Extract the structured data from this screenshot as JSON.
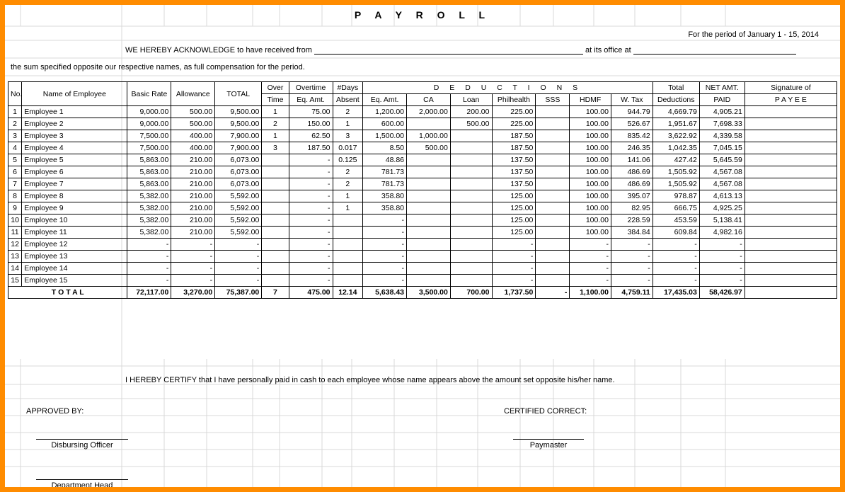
{
  "title": "P A Y R O L L",
  "period_prefix": "For the period of",
  "period_value": "January 1 - 15,  2014",
  "ack_line_1a": "WE HEREBY ACKNOWLEDGE to have received from",
  "ack_line_1b": "at its office at",
  "ack_line_2": "the sum specified opposite our respective names, as full compensation for the period.",
  "headers": {
    "no": "No.",
    "name": "Name of Employee",
    "basic": "Basic Rate",
    "allow": "Allowance",
    "total": "TOTAL",
    "over": "Over",
    "overtime": "Overtime",
    "days": "#Days",
    "deductions": "D  E  D  U  C  T  I  O  N  S",
    "time": "Time",
    "eqamt": "Eq. Amt.",
    "absent": "Absent",
    "eqamt2": "Eq. Amt.",
    "ca": "CA",
    "loan": "Loan",
    "philhealth": "Philhealth",
    "sss": "SSS",
    "hdmf": "HDMF",
    "wtax": "W. Tax",
    "tdeduct": "Total",
    "deductions2": "Deductions",
    "netamt": "NET AMT.",
    "paid": "PAID",
    "sig": "Signature of",
    "payee": "P A Y E E"
  },
  "rows": [
    {
      "no": "1",
      "name": "Employee 1",
      "basic": "9,000.00",
      "allow": "500.00",
      "total": "9,500.00",
      "ot": "1",
      "oeq": "75.00",
      "da": "2",
      "eq": "1,200.00",
      "ca": "2,000.00",
      "loan": "200.00",
      "ph": "225.00",
      "sss": "",
      "hd": "100.00",
      "wt": "944.79",
      "td": "4,669.79",
      "np": "4,905.21"
    },
    {
      "no": "2",
      "name": "Employee 2",
      "basic": "9,000.00",
      "allow": "500.00",
      "total": "9,500.00",
      "ot": "2",
      "oeq": "150.00",
      "da": "1",
      "eq": "600.00",
      "ca": "",
      "loan": "500.00",
      "ph": "225.00",
      "sss": "",
      "hd": "100.00",
      "wt": "526.67",
      "td": "1,951.67",
      "np": "7,698.33"
    },
    {
      "no": "3",
      "name": "Employee 3",
      "basic": "7,500.00",
      "allow": "400.00",
      "total": "7,900.00",
      "ot": "1",
      "oeq": "62.50",
      "da": "3",
      "eq": "1,500.00",
      "ca": "1,000.00",
      "loan": "",
      "ph": "187.50",
      "sss": "",
      "hd": "100.00",
      "wt": "835.42",
      "td": "3,622.92",
      "np": "4,339.58"
    },
    {
      "no": "4",
      "name": "Employee 4",
      "basic": "7,500.00",
      "allow": "400.00",
      "total": "7,900.00",
      "ot": "3",
      "oeq": "187.50",
      "da": "0.017",
      "eq": "8.50",
      "ca": "500.00",
      "loan": "",
      "ph": "187.50",
      "sss": "",
      "hd": "100.00",
      "wt": "246.35",
      "td": "1,042.35",
      "np": "7,045.15"
    },
    {
      "no": "5",
      "name": "Employee 5",
      "basic": "5,863.00",
      "allow": "210.00",
      "total": "6,073.00",
      "ot": "",
      "oeq": "-",
      "da": "0.125",
      "eq": "48.86",
      "ca": "",
      "loan": "",
      "ph": "137.50",
      "sss": "",
      "hd": "100.00",
      "wt": "141.06",
      "td": "427.42",
      "np": "5,645.59"
    },
    {
      "no": "6",
      "name": "Employee 6",
      "basic": "5,863.00",
      "allow": "210.00",
      "total": "6,073.00",
      "ot": "",
      "oeq": "-",
      "da": "2",
      "eq": "781.73",
      "ca": "",
      "loan": "",
      "ph": "137.50",
      "sss": "",
      "hd": "100.00",
      "wt": "486.69",
      "td": "1,505.92",
      "np": "4,567.08"
    },
    {
      "no": "7",
      "name": "Employee 7",
      "basic": "5,863.00",
      "allow": "210.00",
      "total": "6,073.00",
      "ot": "",
      "oeq": "-",
      "da": "2",
      "eq": "781.73",
      "ca": "",
      "loan": "",
      "ph": "137.50",
      "sss": "",
      "hd": "100.00",
      "wt": "486.69",
      "td": "1,505.92",
      "np": "4,567.08"
    },
    {
      "no": "8",
      "name": "Employee 8",
      "basic": "5,382.00",
      "allow": "210.00",
      "total": "5,592.00",
      "ot": "",
      "oeq": "-",
      "da": "1",
      "eq": "358.80",
      "ca": "",
      "loan": "",
      "ph": "125.00",
      "sss": "",
      "hd": "100.00",
      "wt": "395.07",
      "td": "978.87",
      "np": "4,613.13"
    },
    {
      "no": "9",
      "name": "Employee 9",
      "basic": "5,382.00",
      "allow": "210.00",
      "total": "5,592.00",
      "ot": "",
      "oeq": "-",
      "da": "1",
      "eq": "358.80",
      "ca": "",
      "loan": "",
      "ph": "125.00",
      "sss": "",
      "hd": "100.00",
      "wt": "82.95",
      "td": "666.75",
      "np": "4,925.25"
    },
    {
      "no": "10",
      "name": "Employee 10",
      "basic": "5,382.00",
      "allow": "210.00",
      "total": "5,592.00",
      "ot": "",
      "oeq": "-",
      "da": "",
      "eq": "-",
      "ca": "",
      "loan": "",
      "ph": "125.00",
      "sss": "",
      "hd": "100.00",
      "wt": "228.59",
      "td": "453.59",
      "np": "5,138.41"
    },
    {
      "no": "11",
      "name": "Employee 11",
      "basic": "5,382.00",
      "allow": "210.00",
      "total": "5,592.00",
      "ot": "",
      "oeq": "-",
      "da": "",
      "eq": "-",
      "ca": "",
      "loan": "",
      "ph": "125.00",
      "sss": "",
      "hd": "100.00",
      "wt": "384.84",
      "td": "609.84",
      "np": "4,982.16"
    },
    {
      "no": "12",
      "name": "Employee 12",
      "basic": "-",
      "allow": "-",
      "total": "-",
      "ot": "",
      "oeq": "-",
      "da": "",
      "eq": "-",
      "ca": "",
      "loan": "",
      "ph": "-",
      "sss": "",
      "hd": "-",
      "wt": "-",
      "td": "-",
      "np": "-"
    },
    {
      "no": "13",
      "name": "Employee 13",
      "basic": "-",
      "allow": "-",
      "total": "-",
      "ot": "",
      "oeq": "-",
      "da": "",
      "eq": "-",
      "ca": "",
      "loan": "",
      "ph": "-",
      "sss": "",
      "hd": "-",
      "wt": "-",
      "td": "-",
      "np": "-"
    },
    {
      "no": "14",
      "name": "Employee 14",
      "basic": "-",
      "allow": "-",
      "total": "-",
      "ot": "",
      "oeq": "-",
      "da": "",
      "eq": "-",
      "ca": "",
      "loan": "",
      "ph": "-",
      "sss": "",
      "hd": "-",
      "wt": "-",
      "td": "-",
      "np": "-"
    },
    {
      "no": "15",
      "name": "Employee 15",
      "basic": "-",
      "allow": "-",
      "total": "-",
      "ot": "",
      "oeq": "-",
      "da": "",
      "eq": "-",
      "ca": "",
      "loan": "",
      "ph": "-",
      "sss": "",
      "hd": "-",
      "wt": "-",
      "td": "-",
      "np": "-"
    }
  ],
  "totals": {
    "label": "T O T A L",
    "basic": "72,117.00",
    "allow": "3,270.00",
    "total": "75,387.00",
    "ot": "7",
    "oeq": "475.00",
    "da": "12.14",
    "eq": "5,638.43",
    "ca": "3,500.00",
    "loan": "700.00",
    "ph": "1,737.50",
    "sss": "-",
    "hd": "1,100.00",
    "wt": "4,759.11",
    "td": "17,435.03",
    "np": "58,426.97"
  },
  "cert": "I HEREBY CERTIFY  that I have personally paid in cash to each employee whose name appears above the amount set opposite his/her name.",
  "approved": "APPROVED BY:",
  "certcorrect": "CERTIFIED CORRECT:",
  "disbursing": "Disbursing Officer",
  "paymaster": "Paymaster",
  "depthead": "Department Head"
}
